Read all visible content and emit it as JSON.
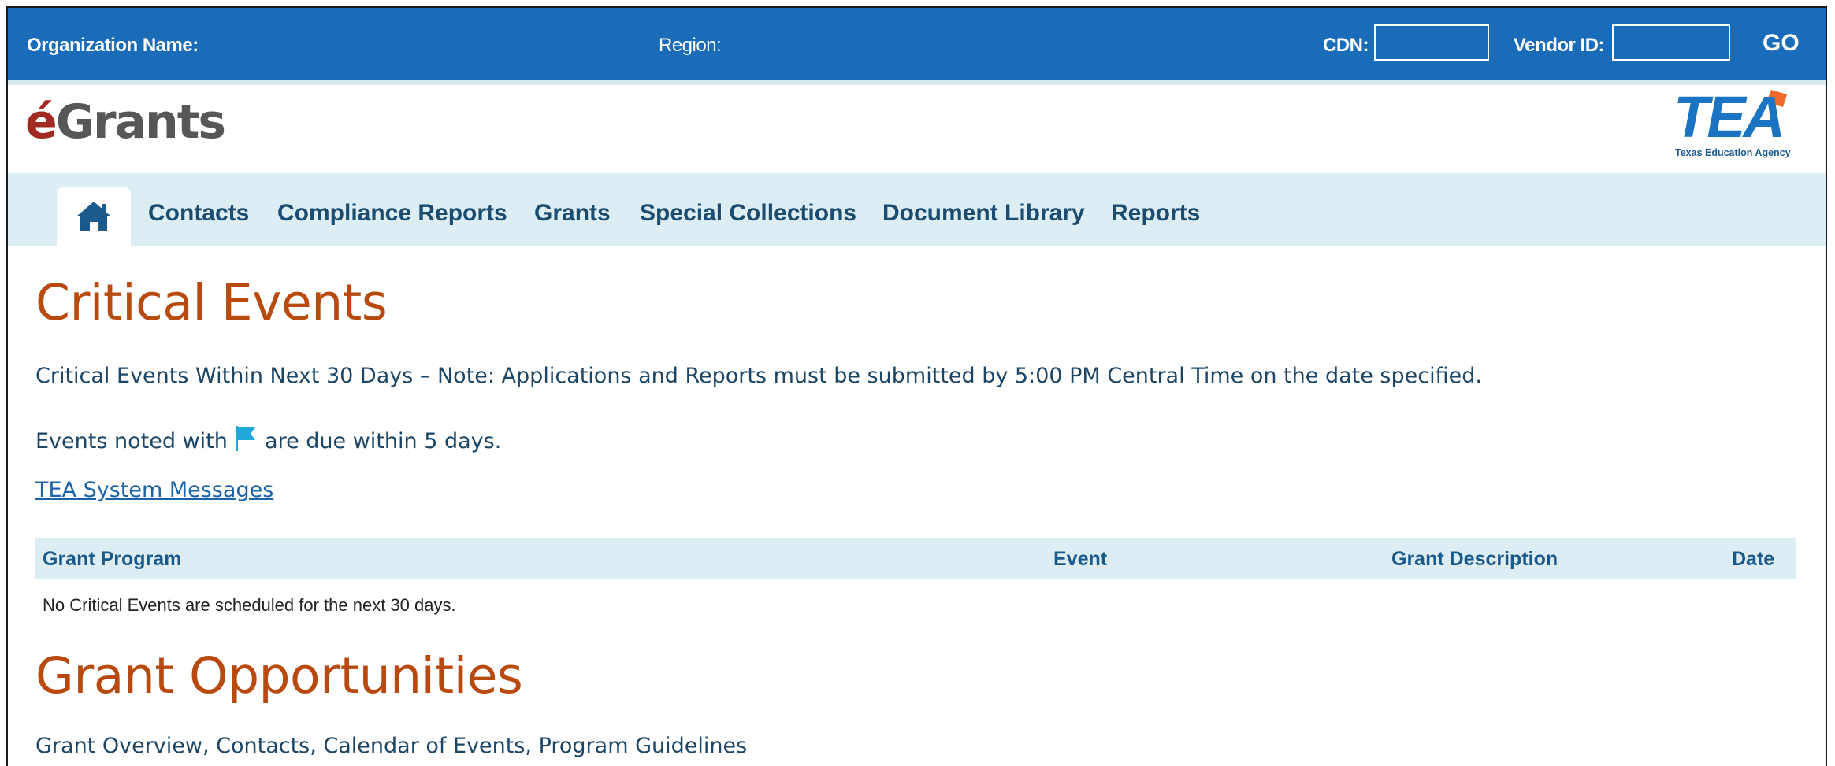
{
  "header": {
    "org_label": "Organization Name:",
    "region_label": "Region:",
    "cdn_label": "CDN:",
    "cdn_value": "",
    "vendor_label": "Vendor ID:",
    "vendor_value": "",
    "go_label": "GO"
  },
  "brand": {
    "logo_e": "é",
    "logo_rest": "Grants",
    "tea_text": "TEA",
    "tea_sub": "Texas Education Agency"
  },
  "nav": {
    "home_icon": "home-icon",
    "items": [
      "Contacts",
      "Compliance Reports",
      "Grants",
      "Special Collections",
      "Document Library",
      "Reports"
    ]
  },
  "critical": {
    "title": "Critical Events",
    "note": "Critical Events Within Next 30 Days – Note: Applications and Reports must be submitted by 5:00 PM Central Time on the date specified.",
    "flag_prefix": "Events noted with",
    "flag_icon": "flag-icon",
    "flag_suffix": "are due within 5 days.",
    "messages_link": "TEA System Messages",
    "columns": [
      "Grant Program",
      "Event",
      "Grant Description",
      "Date"
    ],
    "empty": "No Critical Events are scheduled for the next 30 days."
  },
  "opportunities": {
    "title": "Grant Opportunities",
    "subtitle": "Grant Overview, Contacts, Calendar of Events, Program Guidelines"
  },
  "colors": {
    "top_bar": "#1a6cb8",
    "nav_bg": "#dcedf3",
    "heading": "#b84a0f",
    "link": "#1c63a8",
    "flag": "#1fa7d8"
  }
}
